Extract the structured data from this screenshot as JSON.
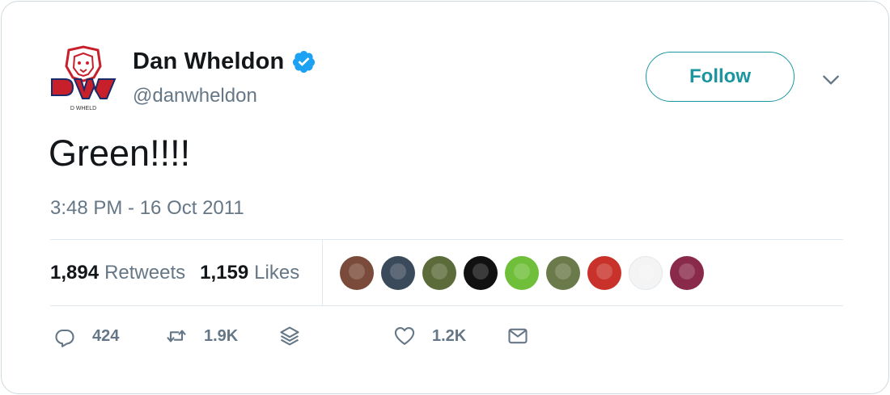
{
  "author": {
    "name": "Dan Wheldon",
    "handle": "@danwheldon",
    "verified": true,
    "avatar_text": "DW",
    "avatar_subtext": "D WHELD"
  },
  "follow_label": "Follow",
  "tweet": {
    "text": "Green!!!!",
    "timestamp": "3:48 PM - 16 Oct 2011"
  },
  "stats": {
    "retweets_count": "1,894",
    "retweets_label": "Retweets",
    "likes_count": "1,159",
    "likes_label": "Likes"
  },
  "likers": [
    {
      "name": "liker-1",
      "color": "#7a4b3a"
    },
    {
      "name": "liker-2",
      "color": "#3b4a5a"
    },
    {
      "name": "liker-3",
      "color": "#5b6b3a"
    },
    {
      "name": "liker-4",
      "color": "#111111"
    },
    {
      "name": "liker-5",
      "color": "#6fbf3a"
    },
    {
      "name": "liker-6",
      "color": "#6b7a4a"
    },
    {
      "name": "liker-7",
      "color": "#c8322a"
    },
    {
      "name": "liker-8",
      "color": "#f4f4f4"
    },
    {
      "name": "liker-9",
      "color": "#8a2a4a"
    }
  ],
  "actions": {
    "replies": "424",
    "retweets": "1.9K",
    "likes": "1.2K"
  },
  "colors": {
    "accent": "#1b95a0",
    "verified": "#1da1f2",
    "secondary_text": "#657786",
    "divider": "#e1e8ed"
  }
}
